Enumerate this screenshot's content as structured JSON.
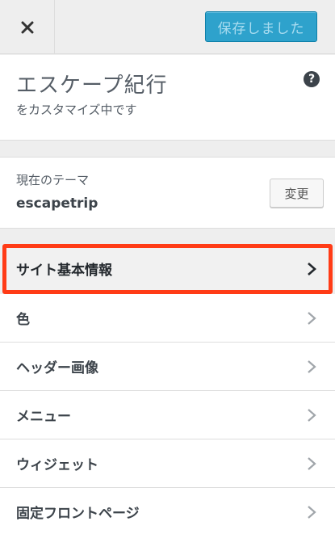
{
  "header": {
    "save_label": "保存しました"
  },
  "site": {
    "title": "エスケープ紀行",
    "subtitle": "をカスタマイズ中です"
  },
  "theme": {
    "label": "現在のテーマ",
    "name": "escapetrip",
    "change_label": "変更"
  },
  "sections": [
    {
      "label": "サイト基本情報",
      "highlighted": true
    },
    {
      "label": "色"
    },
    {
      "label": "ヘッダー画像"
    },
    {
      "label": "メニュー"
    },
    {
      "label": "ウィジェット"
    },
    {
      "label": "固定フロントページ"
    }
  ],
  "colors": {
    "accent": "#2ea2cc",
    "highlight_border": "#ff3b16"
  },
  "icons": {
    "close": "close-icon",
    "help": "help-icon",
    "chevron": "chevron-right-icon"
  }
}
